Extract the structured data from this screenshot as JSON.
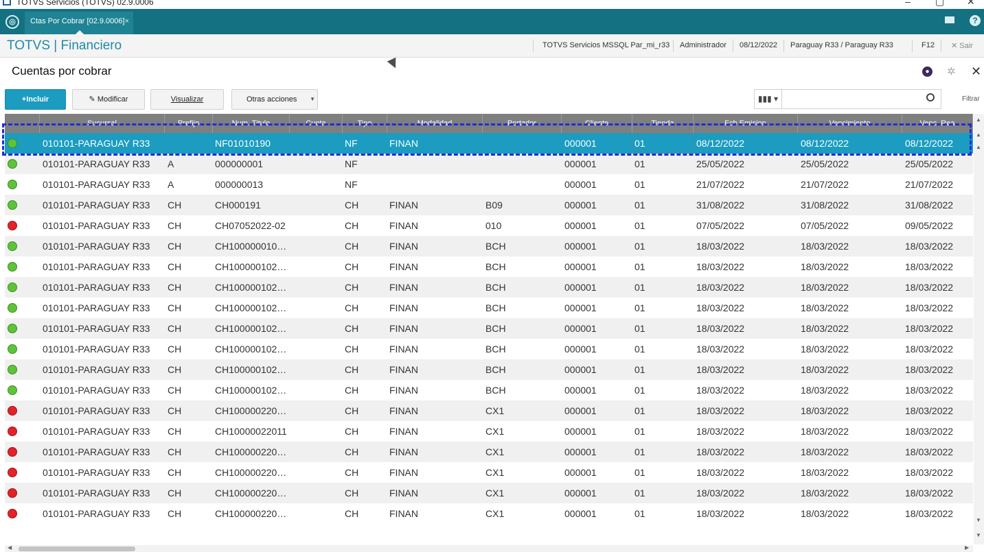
{
  "window": {
    "title": "TOTVS Servicios (TOTVS) 02.9.0006"
  },
  "tab": {
    "label": "Ctas Por Cobrar [02.9.0006]",
    "close": "×"
  },
  "header": {
    "brand": "TOTVS | Financiero",
    "environment": "TOTVS Servicios MSSQL Par_mi_r33",
    "user": "Administrador",
    "date": "08/12/2022",
    "company": "Paraguay R33 / Paraguay R33",
    "f12": "F12",
    "logout": "Sair"
  },
  "page": {
    "title": "Cuentas por cobrar"
  },
  "toolbar": {
    "incluir": "+Incluir",
    "modificar": "Modificar",
    "visualizar": "Visualizar",
    "otras": "Otras acciones",
    "filtrar": "Filtrar"
  },
  "grid": {
    "columns": [
      "Sucursal",
      "Prefijo",
      "Num. Titulo",
      "Cuota",
      "Tipo",
      "Modalidad",
      "Portador",
      "Cliente",
      "Tienda",
      "Fch Emision",
      "Vencimiento",
      "Venc. Rea"
    ],
    "rows": [
      {
        "status": "green",
        "sucursal": "010101-PARAGUAY R33",
        "prefijo": "",
        "num": "NF01010190",
        "cuota": "",
        "tipo": "NF",
        "modalidad": "FINAN",
        "portador": "",
        "cliente": "000001",
        "tienda": "01",
        "emision": "08/12/2022",
        "venc": "08/12/2022",
        "vencrea": "08/12/2022"
      },
      {
        "status": "green",
        "sucursal": "010101-PARAGUAY R33",
        "prefijo": "A",
        "num": "000000001",
        "cuota": "",
        "tipo": "NF",
        "modalidad": "",
        "portador": "",
        "cliente": "000001",
        "tienda": "01",
        "emision": "25/05/2022",
        "venc": "25/05/2022",
        "vencrea": "25/05/2022"
      },
      {
        "status": "green",
        "sucursal": "010101-PARAGUAY R33",
        "prefijo": "A",
        "num": "000000013",
        "cuota": "",
        "tipo": "NF",
        "modalidad": "",
        "portador": "",
        "cliente": "000001",
        "tienda": "01",
        "emision": "21/07/2022",
        "venc": "21/07/2022",
        "vencrea": "21/07/2022"
      },
      {
        "status": "green",
        "sucursal": "010101-PARAGUAY R33",
        "prefijo": "CH",
        "num": "CH000191",
        "cuota": "",
        "tipo": "CH",
        "modalidad": "FINAN",
        "portador": "B09",
        "cliente": "000001",
        "tienda": "01",
        "emision": "31/08/2022",
        "venc": "31/08/2022",
        "vencrea": "31/08/2022"
      },
      {
        "status": "red",
        "sucursal": "010101-PARAGUAY R33",
        "prefijo": "CH",
        "num": "CH07052022-02",
        "cuota": "",
        "tipo": "CH",
        "modalidad": "FINAN",
        "portador": "010",
        "cliente": "000001",
        "tienda": "01",
        "emision": "07/05/2022",
        "venc": "07/05/2022",
        "vencrea": "09/05/2022"
      },
      {
        "status": "green",
        "sucursal": "010101-PARAGUAY R33",
        "prefijo": "CH",
        "num": "CH100000010…",
        "cuota": "",
        "tipo": "CH",
        "modalidad": "FINAN",
        "portador": "BCH",
        "cliente": "000001",
        "tienda": "01",
        "emision": "18/03/2022",
        "venc": "18/03/2022",
        "vencrea": "18/03/2022"
      },
      {
        "status": "green",
        "sucursal": "010101-PARAGUAY R33",
        "prefijo": "CH",
        "num": "CH100000102…",
        "cuota": "",
        "tipo": "CH",
        "modalidad": "FINAN",
        "portador": "BCH",
        "cliente": "000001",
        "tienda": "01",
        "emision": "18/03/2022",
        "venc": "18/03/2022",
        "vencrea": "18/03/2022"
      },
      {
        "status": "green",
        "sucursal": "010101-PARAGUAY R33",
        "prefijo": "CH",
        "num": "CH100000102…",
        "cuota": "",
        "tipo": "CH",
        "modalidad": "FINAN",
        "portador": "BCH",
        "cliente": "000001",
        "tienda": "01",
        "emision": "18/03/2022",
        "venc": "18/03/2022",
        "vencrea": "18/03/2022"
      },
      {
        "status": "green",
        "sucursal": "010101-PARAGUAY R33",
        "prefijo": "CH",
        "num": "CH100000102…",
        "cuota": "",
        "tipo": "CH",
        "modalidad": "FINAN",
        "portador": "BCH",
        "cliente": "000001",
        "tienda": "01",
        "emision": "18/03/2022",
        "venc": "18/03/2022",
        "vencrea": "18/03/2022"
      },
      {
        "status": "green",
        "sucursal": "010101-PARAGUAY R33",
        "prefijo": "CH",
        "num": "CH100000102…",
        "cuota": "",
        "tipo": "CH",
        "modalidad": "FINAN",
        "portador": "BCH",
        "cliente": "000001",
        "tienda": "01",
        "emision": "18/03/2022",
        "venc": "18/03/2022",
        "vencrea": "18/03/2022"
      },
      {
        "status": "green",
        "sucursal": "010101-PARAGUAY R33",
        "prefijo": "CH",
        "num": "CH100000102…",
        "cuota": "",
        "tipo": "CH",
        "modalidad": "FINAN",
        "portador": "BCH",
        "cliente": "000001",
        "tienda": "01",
        "emision": "18/03/2022",
        "venc": "18/03/2022",
        "vencrea": "18/03/2022"
      },
      {
        "status": "green",
        "sucursal": "010101-PARAGUAY R33",
        "prefijo": "CH",
        "num": "CH100000102…",
        "cuota": "",
        "tipo": "CH",
        "modalidad": "FINAN",
        "portador": "BCH",
        "cliente": "000001",
        "tienda": "01",
        "emision": "18/03/2022",
        "venc": "18/03/2022",
        "vencrea": "18/03/2022"
      },
      {
        "status": "green",
        "sucursal": "010101-PARAGUAY R33",
        "prefijo": "CH",
        "num": "CH100000102…",
        "cuota": "",
        "tipo": "CH",
        "modalidad": "FINAN",
        "portador": "BCH",
        "cliente": "000001",
        "tienda": "01",
        "emision": "18/03/2022",
        "venc": "18/03/2022",
        "vencrea": "18/03/2022"
      },
      {
        "status": "red",
        "sucursal": "010101-PARAGUAY R33",
        "prefijo": "CH",
        "num": "CH100000220…",
        "cuota": "",
        "tipo": "CH",
        "modalidad": "FINAN",
        "portador": "CX1",
        "cliente": "000001",
        "tienda": "01",
        "emision": "18/03/2022",
        "venc": "18/03/2022",
        "vencrea": "18/03/2022"
      },
      {
        "status": "red",
        "sucursal": "010101-PARAGUAY R33",
        "prefijo": "CH",
        "num": "CH10000022011",
        "cuota": "",
        "tipo": "CH",
        "modalidad": "FINAN",
        "portador": "CX1",
        "cliente": "000001",
        "tienda": "01",
        "emision": "18/03/2022",
        "venc": "18/03/2022",
        "vencrea": "18/03/2022"
      },
      {
        "status": "red",
        "sucursal": "010101-PARAGUAY R33",
        "prefijo": "CH",
        "num": "CH100000220…",
        "cuota": "",
        "tipo": "CH",
        "modalidad": "FINAN",
        "portador": "CX1",
        "cliente": "000001",
        "tienda": "01",
        "emision": "18/03/2022",
        "venc": "18/03/2022",
        "vencrea": "18/03/2022"
      },
      {
        "status": "red",
        "sucursal": "010101-PARAGUAY R33",
        "prefijo": "CH",
        "num": "CH100000220…",
        "cuota": "",
        "tipo": "CH",
        "modalidad": "FINAN",
        "portador": "CX1",
        "cliente": "000001",
        "tienda": "01",
        "emision": "18/03/2022",
        "venc": "18/03/2022",
        "vencrea": "18/03/2022"
      },
      {
        "status": "red",
        "sucursal": "010101-PARAGUAY R33",
        "prefijo": "CH",
        "num": "CH100000220…",
        "cuota": "",
        "tipo": "CH",
        "modalidad": "FINAN",
        "portador": "CX1",
        "cliente": "000001",
        "tienda": "01",
        "emision": "18/03/2022",
        "venc": "18/03/2022",
        "vencrea": "18/03/2022"
      },
      {
        "status": "red",
        "sucursal": "010101-PARAGUAY R33",
        "prefijo": "CH",
        "num": "CH100000220…",
        "cuota": "",
        "tipo": "CH",
        "modalidad": "FINAN",
        "portador": "CX1",
        "cliente": "000001",
        "tienda": "01",
        "emision": "18/03/2022",
        "venc": "18/03/2022",
        "vencrea": "18/03/2022"
      }
    ]
  },
  "colors": {
    "accent": "#1b9cc0",
    "tabbar": "#137181",
    "status_ok": "#5fc33a",
    "status_bad": "#e0242a"
  }
}
